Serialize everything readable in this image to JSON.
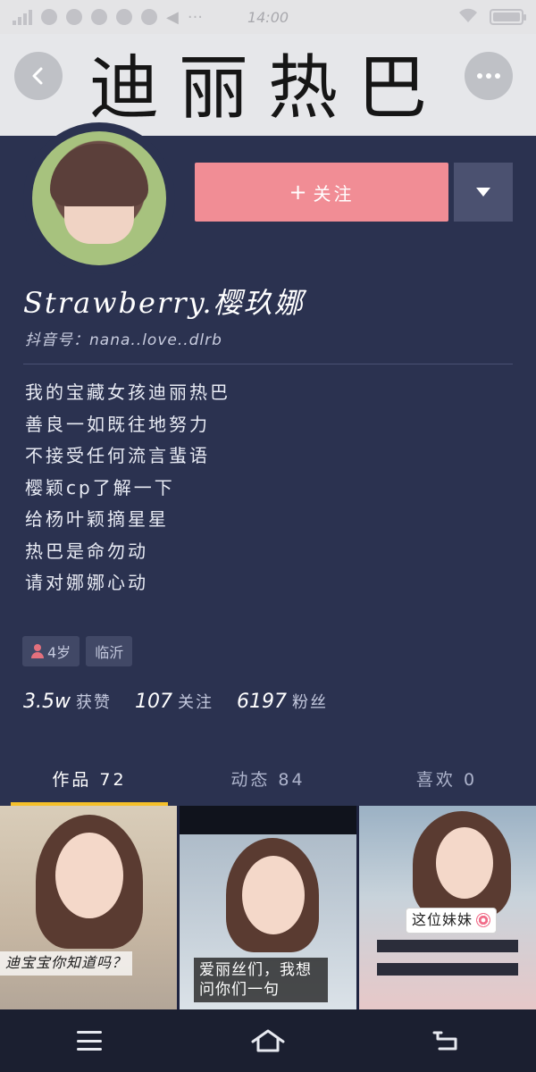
{
  "status_bar": {
    "time": "14:00",
    "left_icons": [
      "signal-icon",
      "weibo-icon",
      "notification-icon",
      "app-icon",
      "alert-icon",
      "app-icon-2",
      "volume-icon",
      "more-icon"
    ],
    "right_icons": [
      "wifi-icon",
      "battery-icon"
    ],
    "battery_level": 1.0
  },
  "header": {
    "title": "迪丽热巴",
    "back_icon": "back-chevron-icon",
    "more_icon": "more-dots-icon"
  },
  "profile": {
    "follow_label": "关注",
    "follow_plus": "+",
    "follow_color": "#f18d95",
    "nickname": "Strawberry.樱玖娜",
    "douyin_id": "抖音号：nana..love..dlrb",
    "bio": [
      "我的宝藏女孩迪丽热巴",
      "善良一如既往地努力",
      "不接受任何流言蜚语",
      "樱颖cp了解一下",
      "给杨叶颖摘星星",
      "热巴是命勿动",
      "请对娜娜心动"
    ],
    "tags": [
      "4岁",
      "临沂"
    ],
    "stats": [
      {
        "num": "3.5w",
        "label": "获赞"
      },
      {
        "num": "107",
        "label": "关注"
      },
      {
        "num": "6197",
        "label": "粉丝"
      }
    ]
  },
  "tabs": [
    {
      "label": "作品 72",
      "active": true
    },
    {
      "label": "动态 84",
      "active": false
    },
    {
      "label": "喜欢 0",
      "active": false
    }
  ],
  "accent_color": "#f5c02a",
  "grid": [
    {
      "caption": "迪宝宝你知道吗？"
    },
    {
      "caption": "爱丽丝们，我想问你们一句"
    },
    {
      "caption": "这位妹妹"
    }
  ],
  "bottom_nav": [
    "menu-icon",
    "home-icon",
    "back-icon"
  ]
}
